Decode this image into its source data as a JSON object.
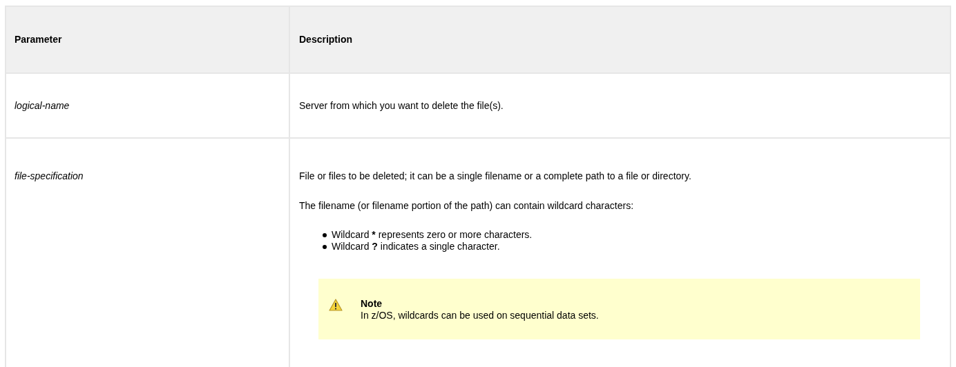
{
  "table": {
    "columns": [
      "Parameter",
      "Description"
    ],
    "rows": [
      {
        "parameter": "logical-name",
        "description": [
          {
            "kind": "paragraph",
            "text": "Server from which you want to delete the file(s)."
          }
        ]
      },
      {
        "parameter": "file-specification",
        "description": [
          {
            "kind": "paragraph",
            "text": "File or files to be deleted; it can be a single filename or a complete path to a file or directory."
          },
          {
            "kind": "paragraph",
            "text": "The filename (or filename portion of the path) can contain wildcard characters:"
          },
          {
            "kind": "list",
            "items": [
              {
                "lead": "Wildcard",
                "symbol": "*",
                "rest": "represents zero or more characters."
              },
              {
                "lead": "Wildcard",
                "symbol": "?",
                "rest": "indicates a single character."
              }
            ]
          },
          {
            "kind": "note",
            "title": "Note",
            "text": "In z/OS, wildcards can be used on sequential data sets."
          }
        ]
      }
    ]
  }
}
